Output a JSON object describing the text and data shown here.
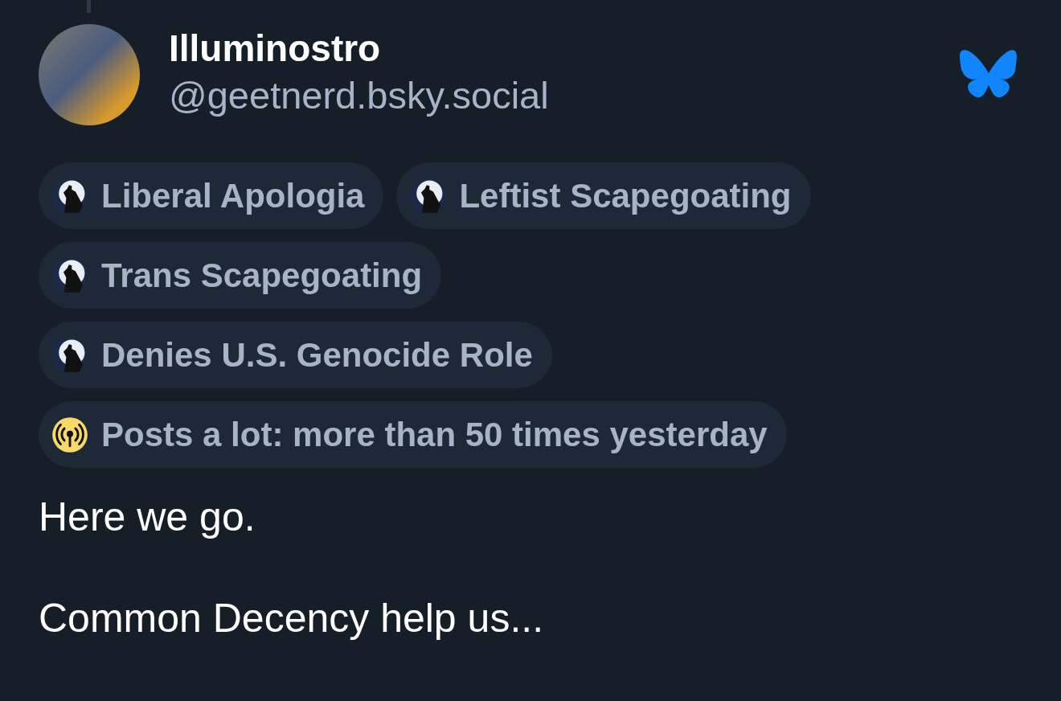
{
  "author": {
    "display_name": "Illuminostro",
    "handle": "@geetnerd.bsky.social"
  },
  "labels": [
    {
      "kind": "figure",
      "text": "Liberal Apologia"
    },
    {
      "kind": "figure",
      "text": "Leftist Scapegoating"
    },
    {
      "kind": "figure",
      "text": "Trans Scapegoating"
    },
    {
      "kind": "figure",
      "text": "Denies U.S. Genocide Role"
    },
    {
      "kind": "broadcast",
      "text": "Posts a lot: more than 50 times yesterday"
    }
  ],
  "post": {
    "paragraphs": [
      "Here we go.",
      "Common Decency help us..."
    ]
  }
}
